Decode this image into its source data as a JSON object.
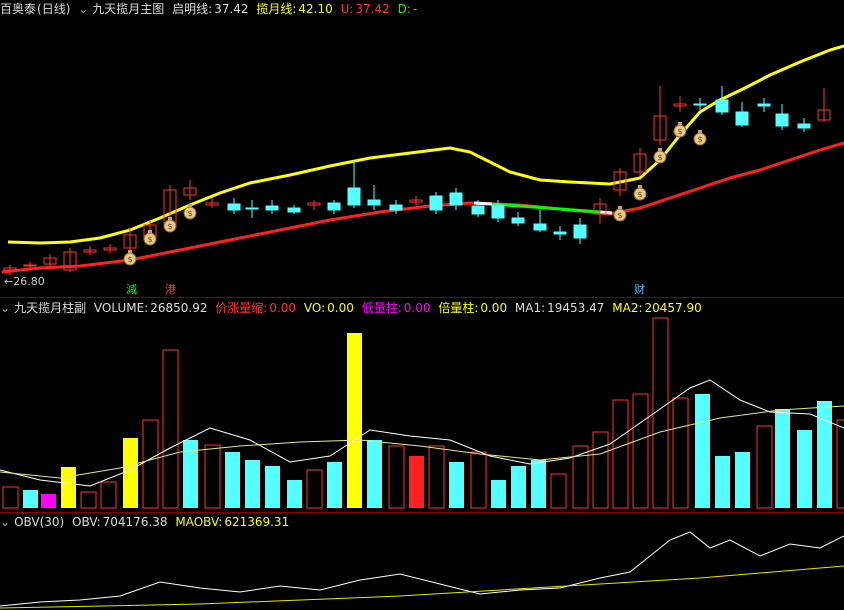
{
  "main_panel": {
    "security_name": "百奥泰",
    "period": "(日线)",
    "indicator": "九天揽月主图",
    "qiming_label": "启明线:",
    "qiming_value": "37.42",
    "lanyue_label": "揽月线:",
    "lanyue_value": "42.10",
    "u_label": "U:",
    "u_value": "37.42",
    "d_label": "D:",
    "d_value": "-",
    "low_price_marker": "←26.80",
    "signal_reduce": "減",
    "signal_port": "港",
    "signal_wealth": "财"
  },
  "volume_panel": {
    "indicator": "九天揽月柱副",
    "volume_label": "VOLUME:",
    "volume_value": "26850.92",
    "jzlt_label": "价涨量缩:",
    "jzlt_value": "0.00",
    "vo_label": "VO:",
    "vo_value": "0.00",
    "dlz_label": "低量柱:",
    "dlz_value": "0.00",
    "blz_label": "倍量柱:",
    "blz_value": "0.00",
    "ma1_label": "MA1:",
    "ma1_value": "19453.47",
    "ma2_label": "MA2:",
    "ma2_value": "20457.90"
  },
  "obv_panel": {
    "indicator": "OBV(30)",
    "obv_label": "OBV:",
    "obv_value": "704176.38",
    "maobv_label": "MAOBV:",
    "maobv_value": "621369.31"
  },
  "colors": {
    "background": "#000000",
    "up_candle": "#ff3232",
    "down_candle": "#54ffff",
    "qiming_line": "#ff2020",
    "lanyue_line": "#ffff00",
    "highlight_volume": "#ffff00",
    "low_volume": "#ff00ff",
    "text_gray": "#c0c0c0"
  },
  "icons": [
    "collapse-icon",
    "money-bag-icon"
  ]
}
